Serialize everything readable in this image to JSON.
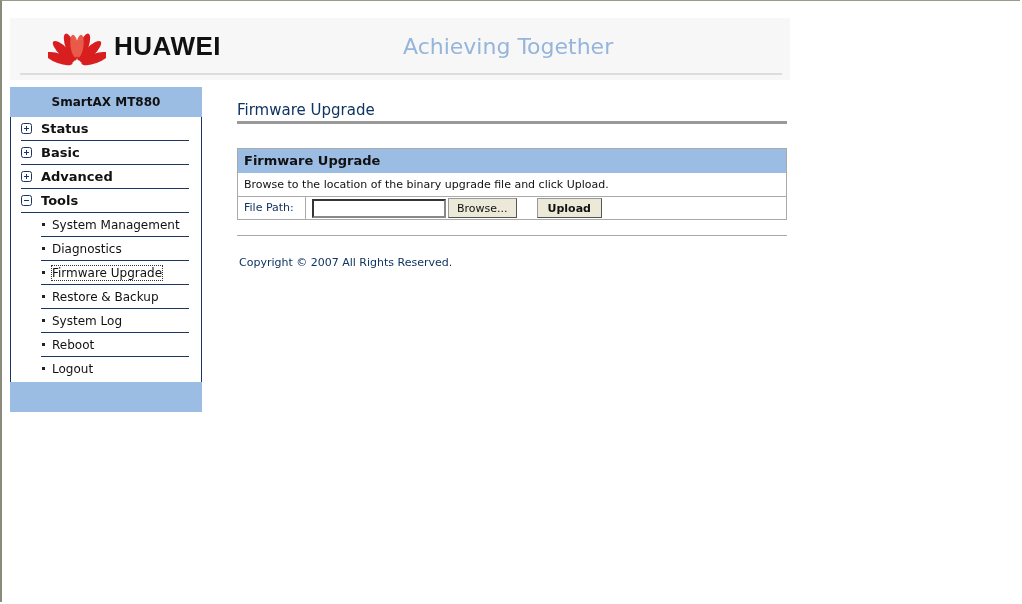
{
  "header": {
    "brand": "HUAWEI",
    "slogan": "Achieving Together"
  },
  "sidebar": {
    "title": "SmartAX MT880",
    "items": [
      {
        "label": "Status",
        "expanded": false
      },
      {
        "label": "Basic",
        "expanded": false
      },
      {
        "label": "Advanced",
        "expanded": false
      },
      {
        "label": "Tools",
        "expanded": true,
        "children": [
          {
            "label": "System Management",
            "selected": false
          },
          {
            "label": "Diagnostics",
            "selected": false
          },
          {
            "label": "Firmware Upgrade",
            "selected": true
          },
          {
            "label": "Restore & Backup",
            "selected": false
          },
          {
            "label": "System Log",
            "selected": false
          },
          {
            "label": "Reboot",
            "selected": false
          },
          {
            "label": "Logout",
            "selected": false
          }
        ]
      }
    ]
  },
  "page_title": "Firmware Upgrade",
  "panel": {
    "title": "Firmware Upgrade",
    "instruction": "Browse to the location of the binary upgrade file and click Upload.",
    "file_label": "File Path:",
    "browse_button": "Browse...",
    "upload_button": "Upload"
  },
  "copyright": "Copyright © 2007 All Rights Reserved."
}
